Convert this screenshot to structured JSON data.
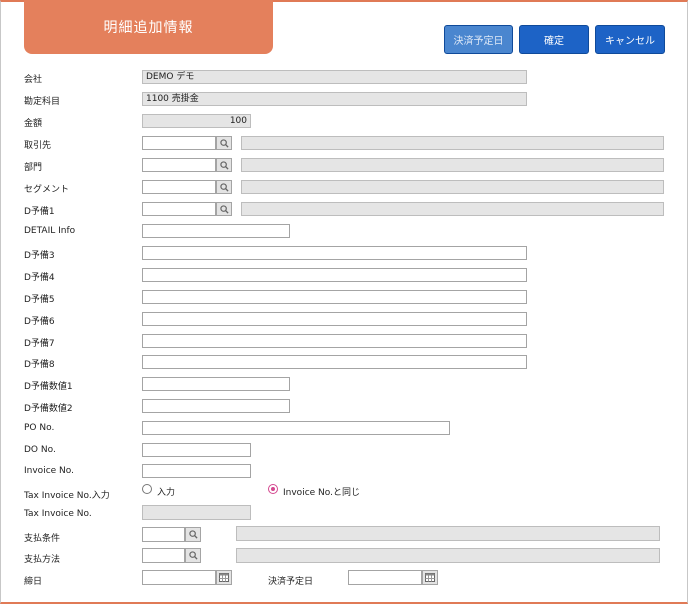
{
  "header": {
    "title": "明細追加情報",
    "btn_due": "決済予定日",
    "btn_confirm": "確定",
    "btn_cancel": "キャンセル"
  },
  "labels": {
    "company": "会社",
    "account": "勘定科目",
    "amount": "金額",
    "partner": "取引先",
    "department": "部門",
    "segment": "セグメント",
    "d1": "D予備1",
    "detail": "DETAIL Info",
    "d3": "D予備3",
    "d4": "D予備4",
    "d5": "D予備5",
    "d6": "D予備6",
    "d7": "D予備7",
    "d8": "D予備8",
    "dnum1": "D予備数値1",
    "dnum2": "D予備数値2",
    "po": "PO No.",
    "do": "DO No.",
    "invoice": "Invoice No.",
    "taxinput": "Tax Invoice No.入力",
    "taxinvoice": "Tax Invoice No.",
    "payterm": "支払条件",
    "paymethod": "支払方法",
    "closing": "締日",
    "duedate": "決済予定日"
  },
  "values": {
    "company": "DEMO デモ",
    "account": "1100 売掛金",
    "amount": "100"
  },
  "radios": {
    "input": "入力",
    "same": "Invoice No.と同じ",
    "selected": "same"
  },
  "icons": {
    "search": "search-icon",
    "calendar": "calendar-icon"
  },
  "colors": {
    "accent": "#e4805c",
    "button": "#1d63c6",
    "radio": "#d4478f"
  }
}
